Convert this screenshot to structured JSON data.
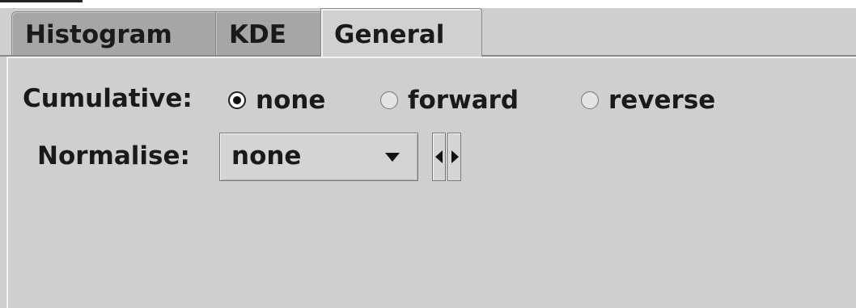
{
  "tabs": [
    {
      "label": "Histogram",
      "active": false
    },
    {
      "label": "KDE",
      "active": false
    },
    {
      "label": "General",
      "active": true
    }
  ],
  "cumulative": {
    "label": "Cumulative:",
    "options": [
      "none",
      "forward",
      "reverse"
    ],
    "selected": "none"
  },
  "normalise": {
    "label": "Normalise:",
    "value": "none"
  },
  "colors": {
    "panel_bg": "#cfcfcf",
    "inactive_tab_bg": "#a6a6a6",
    "text": "#1a1a1a"
  },
  "icons": {
    "combo_arrow": "chevron-down-icon",
    "step_prev": "triangle-left-icon",
    "step_next": "triangle-right-icon"
  }
}
